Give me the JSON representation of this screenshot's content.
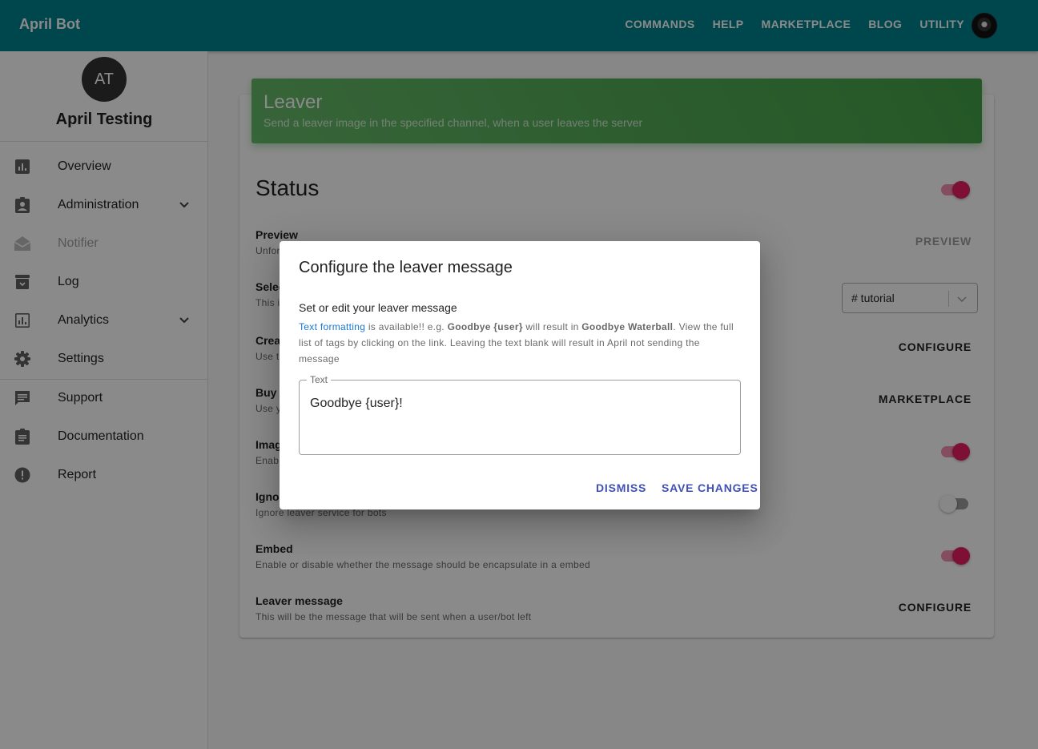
{
  "topbar": {
    "brand": "April Bot",
    "nav": [
      "COMMANDS",
      "HELP",
      "MARKETPLACE",
      "BLOG",
      "UTILITY"
    ]
  },
  "sidebar": {
    "avatar_initials": "AT",
    "server_name": "April Testing",
    "items": [
      {
        "label": "Overview",
        "icon": "bar-chart-icon"
      },
      {
        "label": "Administration",
        "icon": "badge-icon",
        "expandable": true
      },
      {
        "label": "Notifier",
        "icon": "mail-open-icon",
        "disabled": true
      },
      {
        "label": "Log",
        "icon": "archive-icon"
      },
      {
        "label": "Analytics",
        "icon": "analytics-icon",
        "expandable": true
      },
      {
        "label": "Settings",
        "icon": "gear-icon"
      },
      {
        "label": "Support",
        "icon": "chat-icon"
      },
      {
        "label": "Documentation",
        "icon": "clipboard-icon"
      },
      {
        "label": "Report",
        "icon": "alert-icon"
      }
    ]
  },
  "card": {
    "title": "Leaver",
    "subtitle": "Send a leaver image in the specified channel, when a user leaves the server",
    "status_title": "Status",
    "status_on": true,
    "rows": {
      "preview": {
        "title": "Preview",
        "desc": "Unfor",
        "button": "PREVIEW"
      },
      "channel": {
        "title": "Selec",
        "desc": "This i",
        "select_value": "# tutorial"
      },
      "create": {
        "title": "Crea",
        "desc": "Use t",
        "button": "CONFIGURE"
      },
      "buy": {
        "title": "Buy a",
        "desc": "Use y",
        "button": "MARKETPLACE"
      },
      "image": {
        "title": "Imag",
        "desc": "Enab",
        "on": true
      },
      "ignore": {
        "title": "Ignor",
        "desc": "Ignore leaver service for bots",
        "on": false
      },
      "embed": {
        "title": "Embed",
        "desc": "Enable or disable whether the message should be encapsulate in a embed",
        "on": true
      },
      "leaver_message": {
        "title": "Leaver message",
        "desc": "This will be the message that will be sent when a user/bot left",
        "button": "CONFIGURE"
      }
    }
  },
  "dialog": {
    "title": "Configure the leaver message",
    "subtitle": "Set or edit your leaver message",
    "body_link": "Text formatting",
    "body_1": " is available!! e.g. ",
    "body_b1": "Goodbye {user}",
    "body_2": " will result in ",
    "body_b2": "Goodbye Waterball",
    "body_3": ". View the full list of tags by clicking on the link. Leaving the text blank will result in April not sending the message",
    "field_label": "Text",
    "field_value": "Goodbye {user}!",
    "dismiss": "DISMISS",
    "save": "SAVE CHANGES"
  },
  "colors": {
    "topbar": "#00838f",
    "header_green": "#4caf50",
    "switch_on": "#e91e63",
    "dialog_button": "#3f51b5",
    "link": "#1976d2"
  }
}
